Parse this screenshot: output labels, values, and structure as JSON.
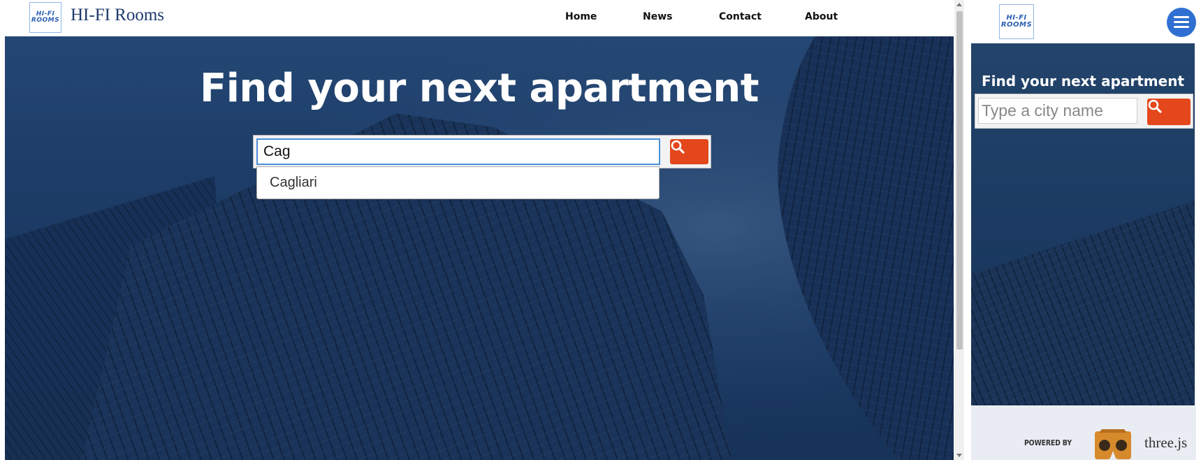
{
  "brand": {
    "logo_line1": "HI-FI",
    "logo_line2": "ROOMS",
    "name": "HI-FI Rooms"
  },
  "nav": {
    "items": [
      {
        "label": "Home"
      },
      {
        "label": "News"
      },
      {
        "label": "Contact"
      },
      {
        "label": "About"
      }
    ]
  },
  "hero": {
    "title": "Find your next apartment"
  },
  "search": {
    "value": "Cag",
    "placeholder": "Type a city name",
    "suggestions": [
      "Cagliari"
    ]
  },
  "footer": {
    "powered_by": "POWERED BY",
    "engine": "three.js"
  },
  "colors": {
    "search_button": "#e4471b",
    "menu_button": "#2f6fd1",
    "input_focus": "#4a90d9"
  },
  "icons": {
    "search": "search-icon",
    "menu": "hamburger-icon",
    "vr": "cardboard-vr-icon"
  }
}
